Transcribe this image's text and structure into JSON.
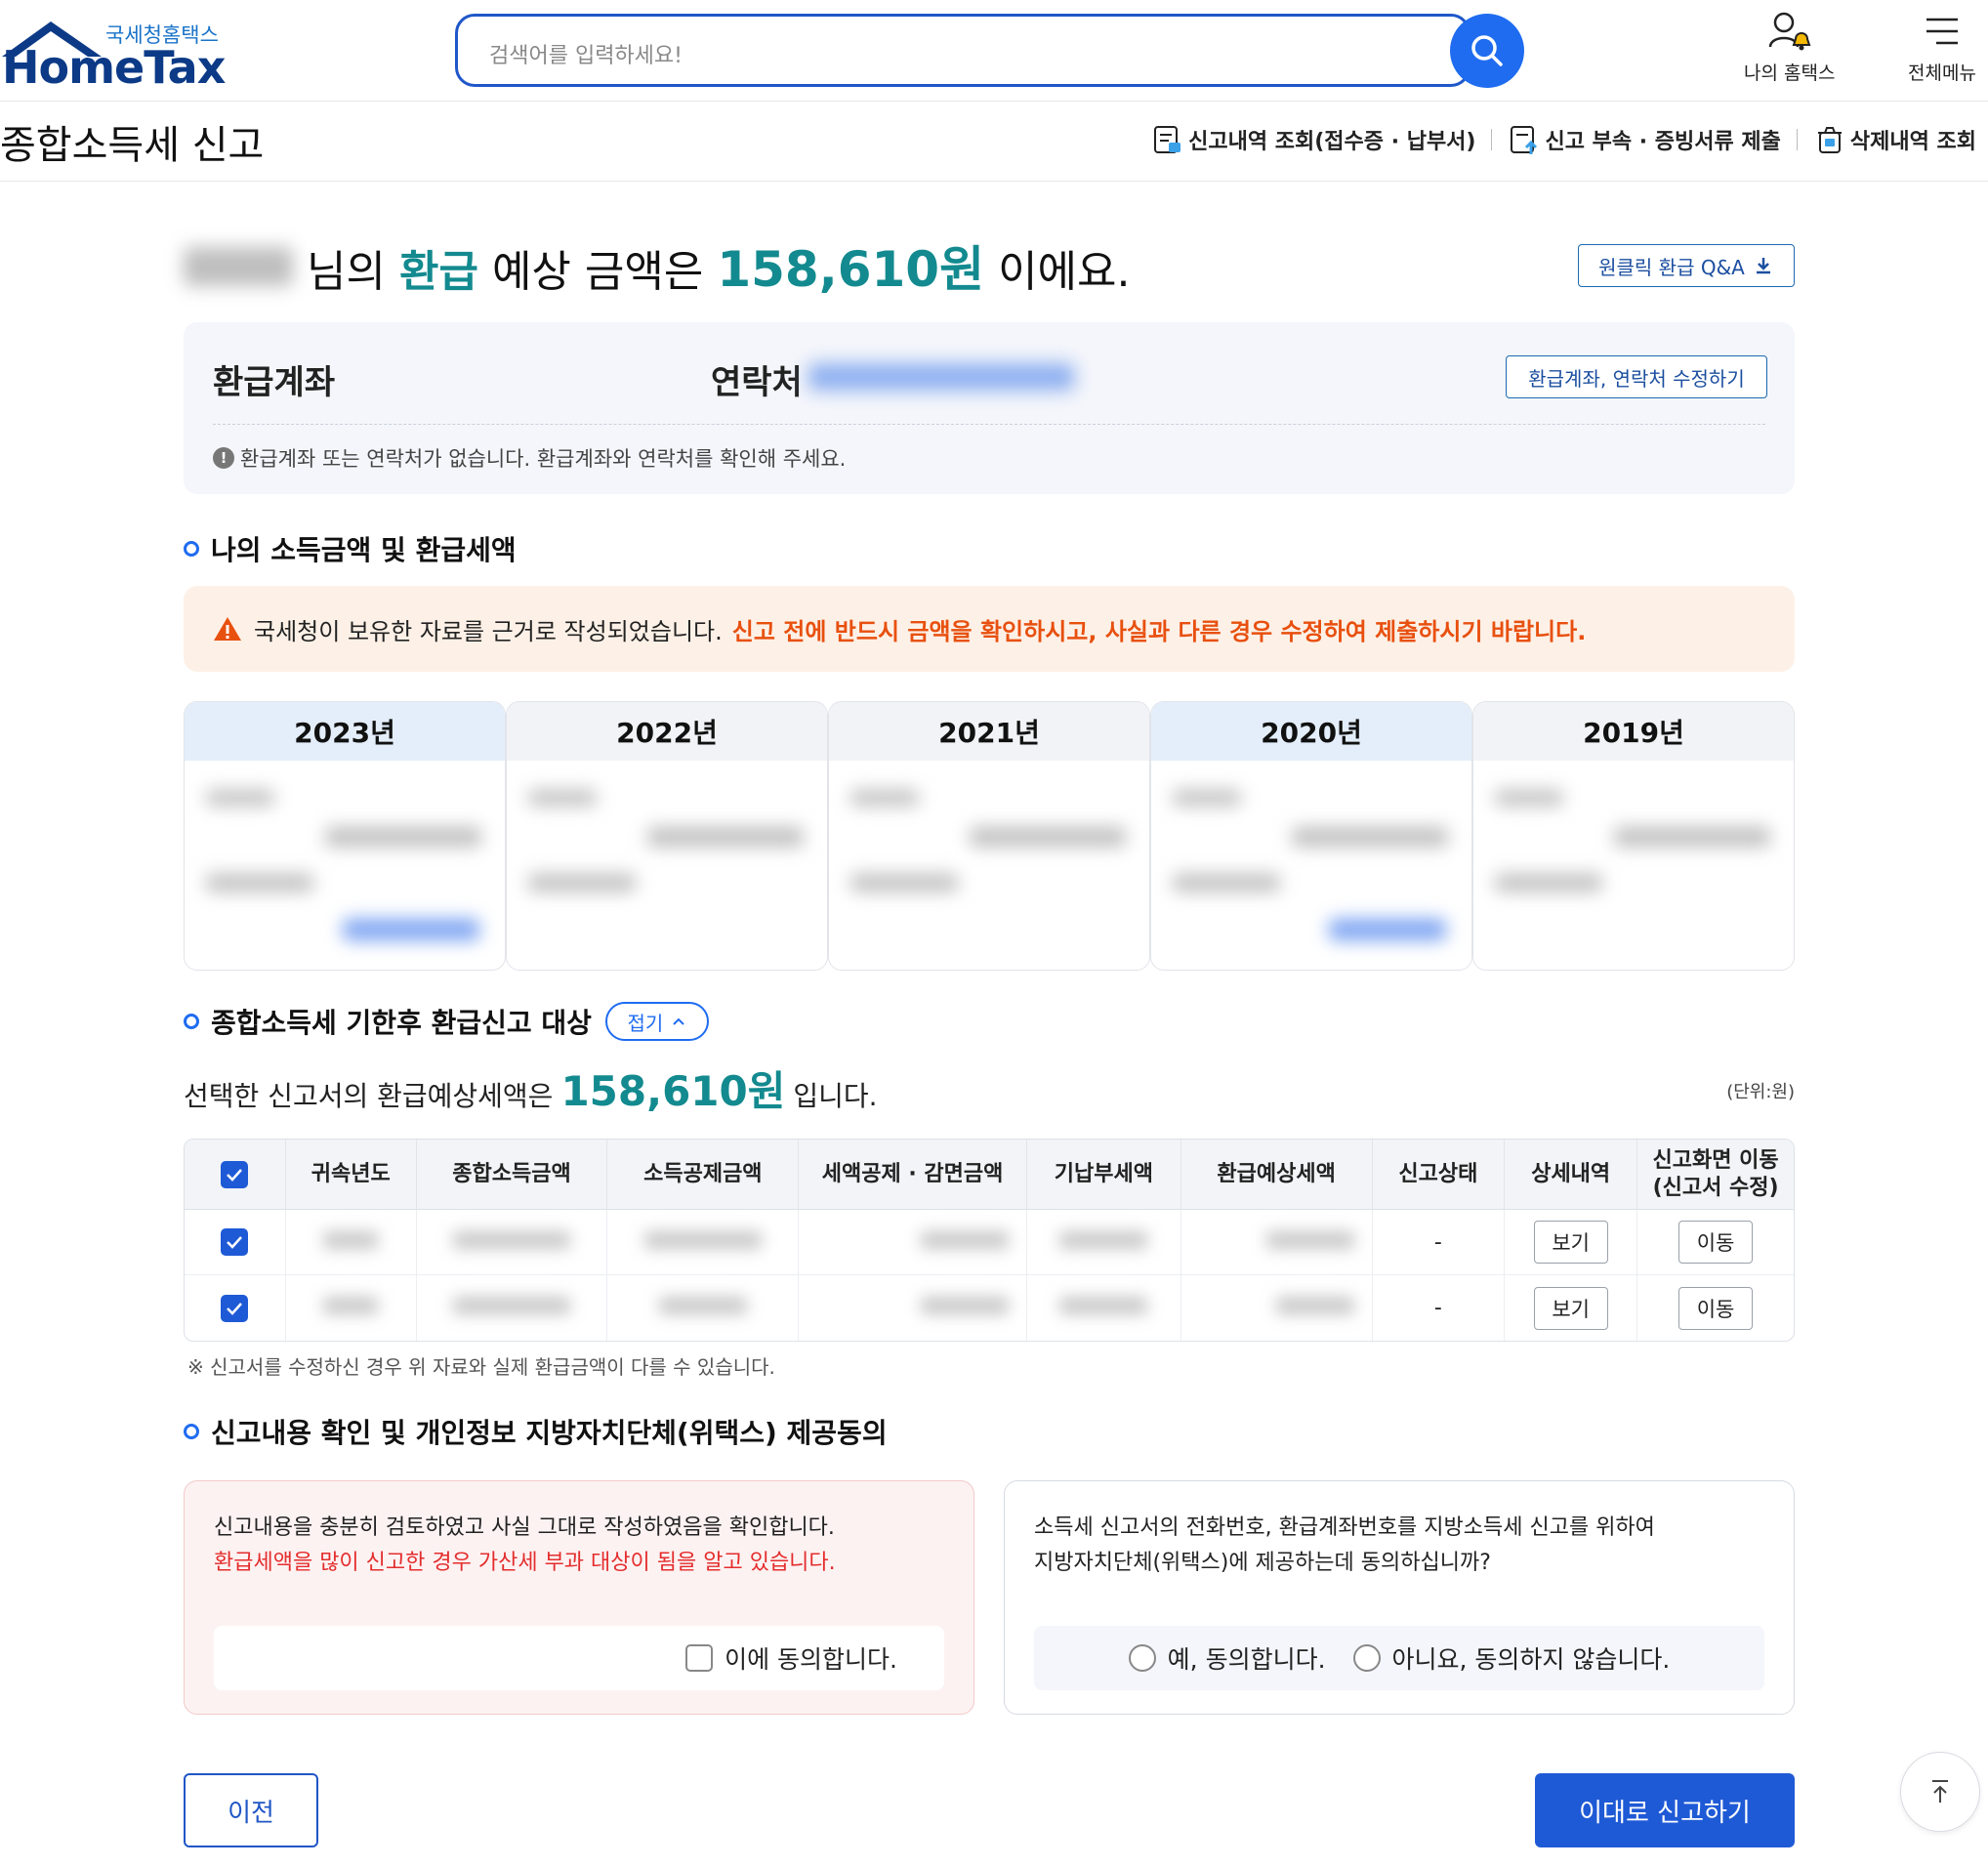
{
  "header": {
    "logo_sub": "국세청홈택스",
    "logo_main": "HomeTax",
    "search_placeholder": "검색어를 입력하세요!",
    "my_hometax": "나의 홈택스",
    "all_menu": "전체메뉴"
  },
  "subheader": {
    "title": "종합소득세 신고",
    "links": [
      "신고내역 조회(접수증 · 납부서)",
      "신고 부속 · 증빙서류 제출",
      "삭제내역 조회"
    ]
  },
  "hero": {
    "prefix": "님의",
    "refund_word": "환급",
    "middle": "예상 금액은",
    "amount": "158,610원",
    "suffix": "이에요.",
    "qa_button": "원클릭 환급 Q&A"
  },
  "account": {
    "refund_account_label": "환급계좌",
    "contact_label": "연락처",
    "edit_button": "환급계좌, 연락처 수정하기",
    "notice": "환급계좌 또는 연락처가 없습니다. 환급계좌와 연락처를 확인해 주세요."
  },
  "section1": {
    "title": "나의 소득금액 및 환급세액",
    "warning_normal": "국세청이 보유한 자료를 근거로 작성되었습니다.",
    "warning_red": "신고 전에 반드시 금액을 확인하시고, 사실과 다른 경우 수정하여 제출하시기 바랍니다.",
    "years": [
      {
        "label": "2023년",
        "selected": true
      },
      {
        "label": "2022년",
        "selected": false
      },
      {
        "label": "2021년",
        "selected": false
      },
      {
        "label": "2020년",
        "selected": true
      },
      {
        "label": "2019년",
        "selected": false
      }
    ]
  },
  "section2": {
    "title": "종합소득세 기한후 환급신고 대상",
    "fold_label": "접기",
    "selected_prefix": "선택한 신고서의 환급예상세액은",
    "selected_amount": "158,610원",
    "selected_suffix": "입니다.",
    "unit": "(단위:원)",
    "columns": [
      "귀속년도",
      "종합소득금액",
      "소득공제금액",
      "세액공제 · 감면금액",
      "기납부세액",
      "환급예상세액",
      "신고상태",
      "상세내역",
      "신고화면 이동 (신고서 수정)"
    ],
    "rows": [
      {
        "status": "-",
        "detail": "보기",
        "move": "이동"
      },
      {
        "status": "-",
        "detail": "보기",
        "move": "이동"
      }
    ],
    "note": "※ 신고서를 수정하신 경우 위 자료와 실제 환급금액이 다를 수 있습니다."
  },
  "section3": {
    "title": "신고내용 확인 및 개인정보 지방자치단체(위택스) 제공동의",
    "left_line1": "신고내용을 충분히 검토하였고 사실 그대로 작성하였음을 확인합니다.",
    "left_line2": "환급세액을 많이 신고한 경우 가산세 부과 대상이 됨을 알고 있습니다.",
    "left_agree": "이에 동의합니다.",
    "right_line1": "소득세 신고서의 전화번호, 환급계좌번호를 지방소득세 신고를 위하여",
    "right_line2": "지방자치단체(위택스)에 제공하는데 동의하십니까?",
    "radio_yes": "예, 동의합니다.",
    "radio_no": "아니요, 동의하지 않습니다."
  },
  "footer": {
    "prev": "이전",
    "submit": "이대로 신고하기"
  },
  "colors": {
    "primary": "#1f5ad6",
    "teal_amount": "#138a8f",
    "warning_red": "#e8500f"
  }
}
